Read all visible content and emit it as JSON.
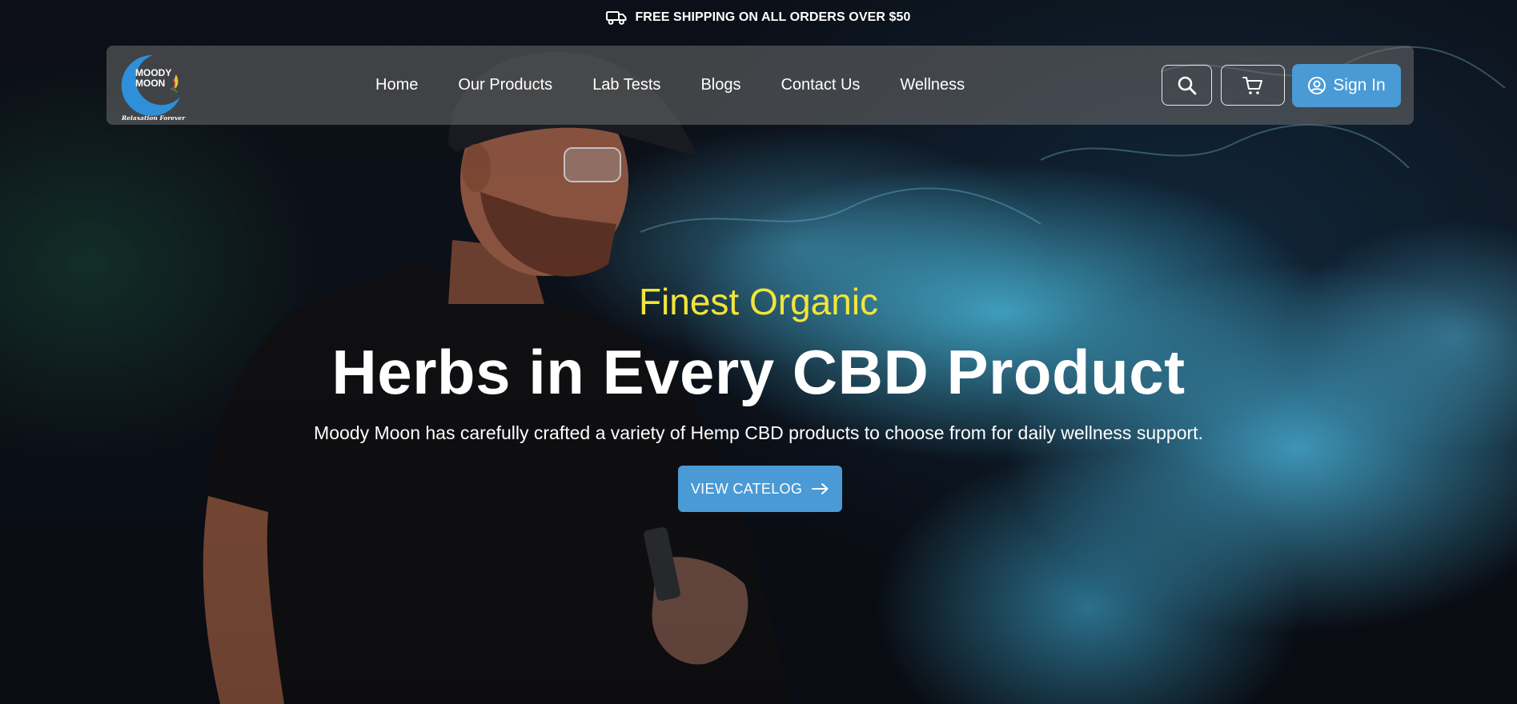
{
  "announcement": {
    "text": "FREE SHIPPING ON ALL ORDERS OVER $50",
    "icon": "truck-icon"
  },
  "logo": {
    "line1": "MOODY",
    "line2": "MOON",
    "tagline": "Relaxation Forever",
    "colors": {
      "ring": "#2f8fd8",
      "leaf": "#e8c531"
    }
  },
  "nav": {
    "links": [
      "Home",
      "Our Products",
      "Lab Tests",
      "Blogs",
      "Contact Us",
      "Wellness"
    ],
    "search_icon": "search-icon",
    "cart_icon": "cart-icon",
    "signin_label": "Sign In",
    "signin_icon": "user-circle-icon"
  },
  "hero": {
    "eyebrow": "Finest Organic",
    "headline": "Herbs in Every CBD Product",
    "subline": "Moody Moon has carefully crafted a variety of Hemp CBD products to choose from for daily wellness support.",
    "cta_label": "VIEW CATELOG",
    "cta_icon": "arrow-right-icon"
  },
  "colors": {
    "accent": "#4a9ad6",
    "eyebrow": "#f2e53a",
    "navbar_bg": "rgba(110,110,110,0.55)"
  }
}
